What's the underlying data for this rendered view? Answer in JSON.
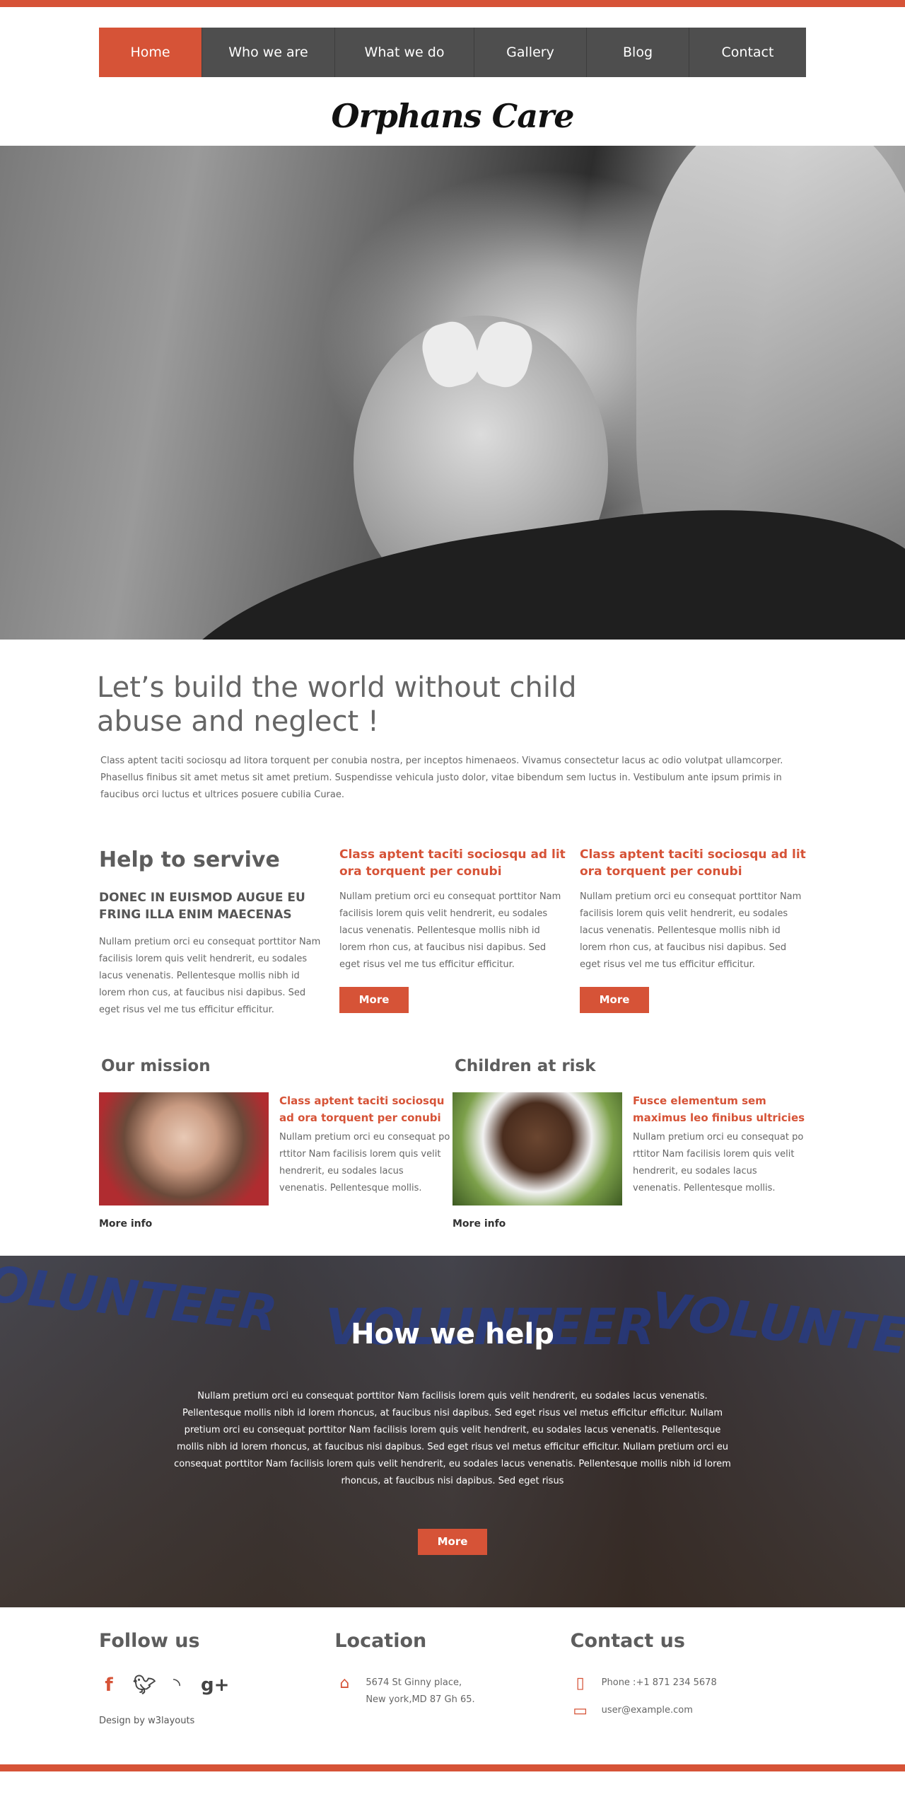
{
  "nav": {
    "items": [
      {
        "label": "Home",
        "active": true
      },
      {
        "label": "Who we are"
      },
      {
        "label": "What we do"
      },
      {
        "label": "Gallery"
      },
      {
        "label": "Blog"
      },
      {
        "label": "Contact"
      }
    ]
  },
  "logo": "Orphans Care",
  "hero": {
    "slides": 3,
    "active_slide": 1
  },
  "intro": {
    "heading": "Let’s build the world without child abuse and neglect !",
    "text": "Class aptent taciti sociosqu ad litora torquent per conubia nostra, per inceptos himenaeos. Vivamus consectetur lacus ac odio volutpat ullamcorper. Phasellus finibus sit amet metus sit amet pretium. Suspendisse vehicula justo dolor, vitae bibendum sem luctus in. Vestibulum ante ipsum primis in faucibus orci luctus et ultrices posuere cubilia Curae."
  },
  "services": {
    "heading": "Help to servive",
    "subheading": "DONEC IN EUISMOD AUGUE EU FRING ILLA ENIM MAECENAS",
    "text": "Nullam pretium orci eu consequat porttitor Nam facilisis lorem quis velit hendrerit, eu sodales lacus venenatis. Pellentesque mollis nibh id lorem rhon cus, at faucibus nisi dapibus. Sed eget risus vel me tus efficitur efficitur.",
    "cards": [
      {
        "title": "Class aptent taciti sociosqu ad lit ora torquent per conubi",
        "text": "Nullam pretium orci eu consequat porttitor Nam facilisis lorem quis velit hendrerit, eu sodales lacus venenatis. Pellentesque mollis nibh id lorem rhon cus, at faucibus nisi dapibus. Sed eget risus vel me tus efficitur efficitur.",
        "button": "More"
      },
      {
        "title": "Class aptent taciti sociosqu ad lit ora torquent per conubi",
        "text": "Nullam pretium orci eu consequat porttitor Nam facilisis lorem quis velit hendrerit, eu sodales lacus venenatis. Pellentesque mollis nibh id lorem rhon cus, at faucibus nisi dapibus. Sed eget risus vel me tus efficitur efficitur.",
        "button": "More"
      }
    ]
  },
  "mission": {
    "heading": "Our mission",
    "title": "Class aptent taciti sociosqu ad ora torquent per conubi",
    "text": "Nullam pretium orci eu consequat po rttitor Nam facilisis lorem quis velit hendrerit, eu sodales lacus venenatis. Pellentesque mollis.",
    "link": "More info"
  },
  "risk": {
    "heading": "Children at risk",
    "title": "Fusce elementum sem maximus leo finibus ultricies",
    "text": "Nullam pretium orci eu consequat po rttitor Nam facilisis lorem quis velit hendrerit, eu sodales lacus venenatis. Pellentesque mollis.",
    "link": "More info"
  },
  "help": {
    "heading": "How we help",
    "text": "Nullam pretium orci eu consequat porttitor Nam facilisis lorem quis velit hendrerit, eu sodales lacus venenatis. Pellentesque mollis nibh id lorem rhoncus, at faucibus nisi dapibus. Sed eget risus vel metus efficitur efficitur. Nullam pretium orci eu consequat porttitor Nam facilisis lorem quis velit hendrerit, eu sodales lacus venenatis. Pellentesque mollis nibh id lorem rhoncus, at faucibus nisi dapibus. Sed eget risus vel metus efficitur efficitur. Nullam pretium orci eu consequat porttitor Nam facilisis lorem quis velit hendrerit, eu sodales lacus venenatis. Pellentesque mollis nibh id lorem rhoncus, at faucibus nisi dapibus. Sed eget risus",
    "button": "More"
  },
  "footer": {
    "follow": {
      "heading": "Follow us",
      "icons": [
        "facebook-icon",
        "twitter-icon",
        "rss-icon",
        "google-plus-icon"
      ],
      "credit": "Design by w3layouts"
    },
    "location": {
      "heading": "Location",
      "line1": "5674 St Ginny place,",
      "line2": "New york,MD 87 Gh 65."
    },
    "contact": {
      "heading": "Contact us",
      "phone": "Phone :+1 871 234 5678",
      "email": "user@example.com"
    }
  },
  "colors": {
    "accent": "#d65337",
    "nav": "#4e4e4e",
    "text": "#666666"
  }
}
